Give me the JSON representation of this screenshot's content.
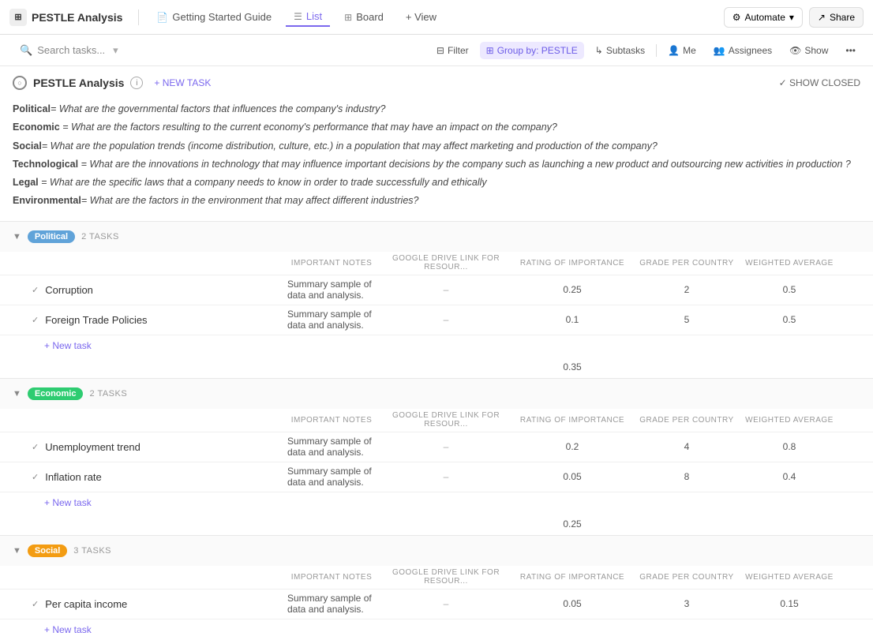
{
  "app": {
    "title": "PESTLE Analysis",
    "logo_icon": "☰"
  },
  "nav": {
    "tabs": [
      {
        "label": "Getting Started Guide",
        "icon": "📄",
        "active": false
      },
      {
        "label": "List",
        "icon": "☰",
        "active": true
      },
      {
        "label": "Board",
        "icon": "⊞",
        "active": false
      },
      {
        "label": "+ View",
        "icon": "",
        "active": false
      }
    ],
    "automate_label": "Automate",
    "share_label": "Share"
  },
  "toolbar": {
    "search_placeholder": "Search tasks...",
    "filter_label": "Filter",
    "group_by_label": "Group by: PESTLE",
    "subtasks_label": "Subtasks",
    "me_label": "Me",
    "assignees_label": "Assignees",
    "show_label": "Show",
    "more_label": "•••"
  },
  "section": {
    "title": "PESTLE Analysis",
    "add_task_label": "+ NEW TASK",
    "show_closed_label": "✓ SHOW CLOSED",
    "descriptions": [
      {
        "bold": "Political",
        "italic": "= What are the governmental factors that influences the company's industry?"
      },
      {
        "bold": "Economic",
        "italic": " = What are the factors resulting to the current economy's performance that may have an impact on the company?"
      },
      {
        "bold": "Social",
        "italic": "= What are the population trends (income distribution, culture, etc.) in a population that may affect marketing and production of the company?"
      },
      {
        "bold": "Technological",
        "italic": " = What are the innovations in technology that may influence important decisions by the company such as launching a new product and outsourcing new activities in production ?"
      },
      {
        "bold": "Legal",
        "italic": " = What are the specific laws that a company needs to know in order to trade successfully and ethically"
      },
      {
        "bold": "Environmental",
        "italic": "= What are the factors in the environment that may affect different industries?"
      }
    ]
  },
  "column_headers": {
    "task": "",
    "important_notes": "IMPORTANT NOTES",
    "google_drive": "GOOGLE DRIVE LINK FOR RESOUR...",
    "rating": "RATING OF IMPORTANCE",
    "grade": "GRADE PER COUNTRY",
    "weighted_avg": "WEIGHTED AVERAGE",
    "add": ""
  },
  "groups": [
    {
      "id": "political",
      "label": "Political",
      "tag_class": "tag-political",
      "task_count": "2 TASKS",
      "tasks": [
        {
          "name": "Corruption",
          "notes": "Summary sample of data and analysis.",
          "google_drive": "–",
          "rating": "0.25",
          "grade": "2",
          "weighted_avg": "0.5"
        },
        {
          "name": "Foreign Trade Policies",
          "notes": "Summary sample of data and analysis.",
          "google_drive": "–",
          "rating": "0.1",
          "grade": "5",
          "weighted_avg": "0.5"
        }
      ],
      "subtotal": "0.35",
      "new_task_label": "+ New task"
    },
    {
      "id": "economic",
      "label": "Economic",
      "tag_class": "tag-economic",
      "task_count": "2 TASKS",
      "tasks": [
        {
          "name": "Unemployment trend",
          "notes": "Summary sample of data and analysis.",
          "google_drive": "–",
          "rating": "0.2",
          "grade": "4",
          "weighted_avg": "0.8"
        },
        {
          "name": "Inflation rate",
          "notes": "Summary sample of data and analysis.",
          "google_drive": "–",
          "rating": "0.05",
          "grade": "8",
          "weighted_avg": "0.4"
        }
      ],
      "subtotal": "0.25",
      "new_task_label": "+ New task"
    },
    {
      "id": "social",
      "label": "Social",
      "tag_class": "tag-social",
      "task_count": "3 TASKS",
      "tasks": [
        {
          "name": "Per capita income",
          "notes": "Summary sample of data and analysis.",
          "google_drive": "–",
          "rating": "0.05",
          "grade": "3",
          "weighted_avg": "0.15"
        }
      ],
      "subtotal": "",
      "new_task_label": "+ New task"
    }
  ]
}
